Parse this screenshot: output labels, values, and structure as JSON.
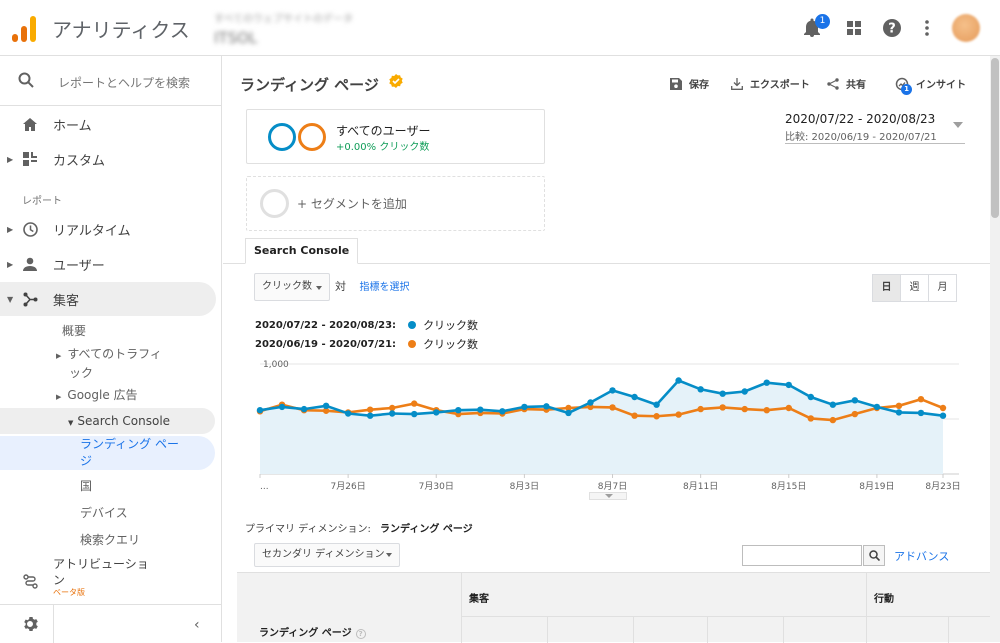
{
  "app": {
    "title": "アナリティクス",
    "account_line1": "すべてのウェブサイトのデータ",
    "account_line2": "ITSOL",
    "notification_count": "1"
  },
  "sidebar": {
    "search_placeholder": "レポートとヘルプを検索",
    "home": "ホーム",
    "custom": "カスタム",
    "section_reports": "レポート",
    "realtime": "リアルタイム",
    "users": "ユーザー",
    "acquisition": "集客",
    "sub": {
      "overview": "概要",
      "all_traffic_1": "すべてのトラフィ",
      "all_traffic_2": "ック",
      "google_ads": "Google 広告",
      "search_console": "Search Console",
      "landing_pages_1": "ランディング ペー",
      "landing_pages_2": "ジ",
      "country": "国",
      "devices": "デバイス",
      "queries": "検索クエリ"
    },
    "attribution_1": "アトリビューショ",
    "attribution_2": "ン",
    "attribution_beta": "ベータ版"
  },
  "main": {
    "title": "ランディング ページ",
    "toolbar": {
      "save": "保存",
      "export": "エクスポート",
      "share": "共有",
      "insights": "インサイト",
      "insights_badge": "1"
    },
    "segment": {
      "name": "すべてのユーザー",
      "sub": "+0.00% クリック数",
      "add": "+ セグメントを追加"
    },
    "date": {
      "range": "2020/07/22 - 2020/08/23",
      "compare": "比較: 2020/06/19 - 2020/07/21"
    },
    "tab": "Search Console",
    "metric": "クリック数",
    "vs": "対",
    "select_metric": "指標を選択",
    "granularity": [
      "日",
      "週",
      "月"
    ],
    "legend": [
      {
        "period": "2020/07/22 - 2020/08/23:",
        "name": "クリック数",
        "color": "#058DC7"
      },
      {
        "period": "2020/06/19 - 2020/07/21:",
        "name": "クリック数",
        "color": "#ED7E17"
      }
    ],
    "primary_dimension_label": "プライマリ ディメンション:",
    "primary_dimension_value": "ランディング ページ",
    "secondary_dimension": "セカンダリ ディメンション",
    "advanced": "アドバンス",
    "table": {
      "col_landing": "ランディング ページ",
      "group_acquisition": "集客",
      "group_behavior": "行動"
    }
  },
  "chart_data": {
    "type": "line",
    "ylim": [
      0,
      1000
    ],
    "y_ticks": [
      "1,000",
      "500"
    ],
    "x_labels": [
      "...",
      "7月26日",
      "7月30日",
      "8月3日",
      "8月7日",
      "8月11日",
      "8月15日",
      "8月19日",
      "8月23日"
    ],
    "series": [
      {
        "name": "クリック数",
        "color": "#058DC7",
        "values": [
          580,
          610,
          590,
          620,
          550,
          530,
          550,
          545,
          560,
          580,
          585,
          570,
          610,
          615,
          555,
          650,
          760,
          700,
          630,
          850,
          770,
          730,
          750,
          830,
          810,
          700,
          630,
          670,
          610,
          560,
          555,
          530
        ]
      },
      {
        "name": "クリック数",
        "color": "#ED7E17",
        "values": [
          570,
          630,
          580,
          575,
          560,
          585,
          600,
          640,
          580,
          545,
          555,
          550,
          590,
          585,
          600,
          610,
          605,
          530,
          525,
          540,
          590,
          605,
          590,
          580,
          600,
          505,
          490,
          545,
          600,
          620,
          680,
          600
        ]
      }
    ]
  }
}
